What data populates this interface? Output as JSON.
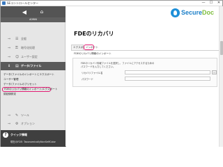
{
  "window": {
    "title": "SEコントロールセンター",
    "controls": [
      "—",
      "☐",
      "✕"
    ]
  },
  "sidebar": {
    "back_glyph": "◀",
    "home_glyph": "⌂",
    "user": "ADMIN",
    "items": [
      {
        "label": "全般",
        "icon": "list-icon",
        "glyph": "☰"
      },
      {
        "label": "暗号化処理",
        "icon": "lock-icon",
        "glyph": "⚿"
      },
      {
        "label": "ユーザー設定",
        "icon": "user-icon",
        "glyph": "☺"
      },
      {
        "label": "データ/ファイル",
        "icon": "data-icon",
        "glyph": "▤"
      }
    ],
    "subitems": [
      "データ/ファイルのインポートとエクスポート",
      "ユーザー管理",
      "データ/ファイルのプリセット",
      "FDEのリカバリ情報のインポート/エクスポート",
      "認証値設定"
    ],
    "bottom_items": [
      {
        "label": "ツール",
        "icon": "tool-icon",
        "glyph": "✎"
      },
      {
        "label": "オプション",
        "icon": "gear-icon",
        "glyph": "⚙"
      }
    ],
    "chevron": "⇒",
    "quick": {
      "icon_glyph": "?",
      "title": "クイック情報",
      "text": "現在のFDE: TaxonomicallyNonSelfColor"
    }
  },
  "main": {
    "logo": {
      "secure": "Secure",
      "doc": "Doc"
    },
    "page_title": "FDEのリカバリ",
    "tabs": [
      "エクスポート",
      "インポート"
    ],
    "section_title": "FDEのリカバリ情報のインポート",
    "description_lines": [
      "FDEのリカバリ情報ファイルを選択し、ファイルにアクセスするための",
      "パスワードを入力してください。"
    ],
    "file_label": "リカバリファイル名",
    "password_label": "パスワード",
    "browse_label": "..."
  }
}
